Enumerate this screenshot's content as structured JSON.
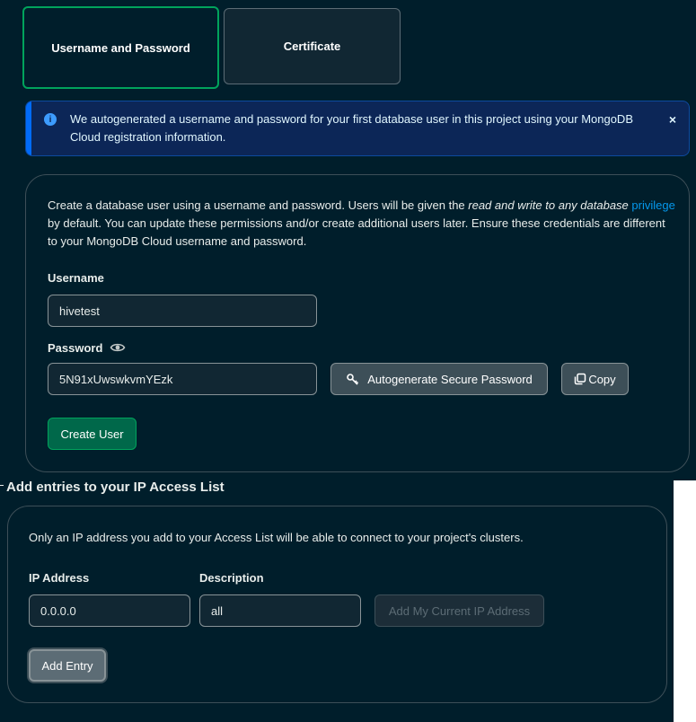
{
  "auth_methods": {
    "username_password": "Username and Password",
    "certificate": "Certificate"
  },
  "banner": {
    "icon": "info-icon",
    "text": "We autogenerated a username and password for your first database user in this project using your MongoDB Cloud registration information.",
    "close": "×"
  },
  "db_user": {
    "description_pre": "Create a database user using a username and password. Users will be given the ",
    "description_em": "read and write to any database",
    "description_link": "privilege",
    "description_post": " by default. You can update these permissions and/or create additional users later. Ensure these credentials are different to your MongoDB Cloud username and password.",
    "username_label": "Username",
    "username_value": "hivetest",
    "password_label": "Password",
    "password_value": "5N91xUwswkvmYEzk",
    "autogenerate_label": "Autogenerate Secure Password",
    "copy_label": "Copy",
    "create_label": "Create User"
  },
  "ip_access": {
    "title": "Add entries to your IP Access List",
    "description": "Only an IP address you add to your Access List will be able to connect to your project's clusters.",
    "ip_label": "IP Address",
    "ip_value": "0.0.0.0",
    "desc_label": "Description",
    "desc_value": "all",
    "current_ip_label": "Add My Current IP Address",
    "add_entry_label": "Add Entry"
  },
  "colors": {
    "background": "#001e2b",
    "accent_green": "#00a35c",
    "primary_button": "#00684a",
    "banner_bg": "#0c2657",
    "link": "#0498ec"
  }
}
